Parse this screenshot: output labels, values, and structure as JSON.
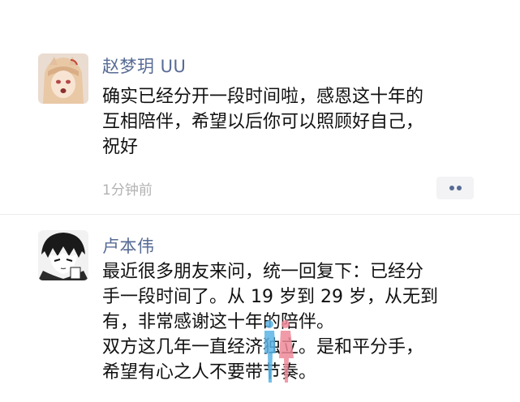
{
  "posts": [
    {
      "author": "赵梦玥 UU",
      "avatar_icon": "anime-girl-avatar-icon",
      "body_lines": [
        "确实已经分开一段时间啦，感恩这十年的",
        "互相陪伴，希望以后你可以照顾好自己，",
        "祝好"
      ],
      "time": "1分钟前",
      "more_icon": "more-dots-icon"
    },
    {
      "author": "卢本伟",
      "avatar_icon": "anime-boy-avatar-icon",
      "body_lines": [
        "最近很多朋友来问，统一回复下：已经分",
        "手一段时间了。从 19 岁到 29 岁，从无到",
        "有，非常感谢这十年的陪伴。",
        "双方这几年一直经济独立。是和平分手，",
        "希望有心之人不要带节奏。"
      ]
    }
  ],
  "colors": {
    "name": "#576b95",
    "text": "#111111",
    "time": "#b2b2b2",
    "divider": "#ececec",
    "figure_blue": "#5ab4e6",
    "figure_pink": "#ef8a9a"
  }
}
